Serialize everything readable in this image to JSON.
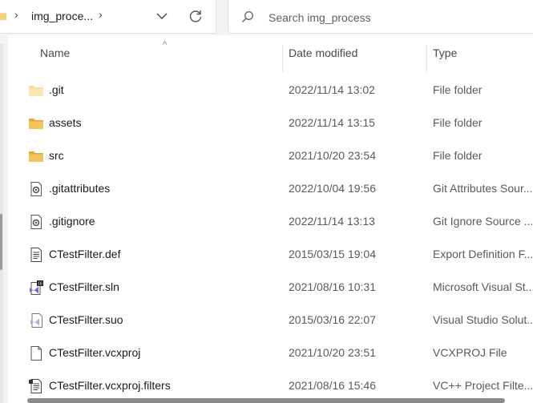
{
  "address_bar": {
    "breadcrumb": "img_proce...",
    "separator": "›"
  },
  "search": {
    "placeholder": "Search img_process",
    "value": ""
  },
  "columns": {
    "name": "Name",
    "date": "Date modified",
    "type": "Type",
    "sort_indicator": "^"
  },
  "files": [
    {
      "name": ".git",
      "date": "2022/11/14 13:02",
      "type": "File folder",
      "icon": "folder-icon"
    },
    {
      "name": "assets",
      "date": "2022/11/14 13:15",
      "type": "File folder",
      "icon": "folder-icon"
    },
    {
      "name": "src",
      "date": "2021/10/20 23:54",
      "type": "File folder",
      "icon": "folder-icon"
    },
    {
      "name": ".gitattributes",
      "date": "2022/10/04 19:56",
      "type": "Git Attributes Sour...",
      "icon": "settings-file-icon"
    },
    {
      "name": ".gitignore",
      "date": "2022/11/14 13:13",
      "type": "Git Ignore Source ...",
      "icon": "settings-file-icon"
    },
    {
      "name": "CTestFilter.def",
      "date": "2015/03/15 19:04",
      "type": "Export Definition F...",
      "icon": "text-file-icon"
    },
    {
      "name": "CTestFilter.sln",
      "date": "2021/08/16 10:31",
      "type": "Microsoft Visual St...",
      "icon": "vs-solution-icon"
    },
    {
      "name": "CTestFilter.suo",
      "date": "2015/03/16 22:07",
      "type": "Visual Studio Solut...",
      "icon": "vs-suo-icon"
    },
    {
      "name": "CTestFilter.vcxproj",
      "date": "2021/10/20 23:51",
      "type": "VCXPROJ File",
      "icon": "blank-file-icon"
    },
    {
      "name": "CTestFilter.vcxproj.filters",
      "date": "2021/08/16 15:46",
      "type": "VC++ Project Filte...",
      "icon": "filters-file-icon"
    }
  ],
  "colors": {
    "folder": "#f2c55c",
    "folder_dark": "#e0a93b",
    "vs_purple": "#8661c5"
  }
}
